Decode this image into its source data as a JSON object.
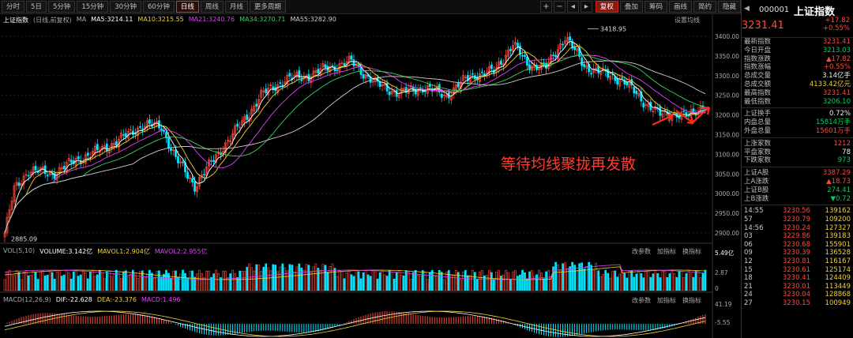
{
  "toolbar": {
    "periods": [
      "分时",
      "5日",
      "5分钟",
      "15分钟",
      "30分钟",
      "60分钟",
      "日线",
      "周线",
      "月线",
      "更多周期"
    ],
    "active_period": "日线",
    "right_buttons": [
      "复权",
      "叠加",
      "筹码",
      "画线",
      "简约",
      "隐藏"
    ],
    "plus": "+",
    "minus": "−",
    "left": "◂",
    "right": "▸"
  },
  "main_panel": {
    "title": "上证指数",
    "sub": "(日线,前复权)",
    "ma_label": "MA",
    "ma": [
      {
        "label": "MA5:3214.11",
        "color": "#ffffff"
      },
      {
        "label": "MA10:3215.55",
        "color": "#f2d230"
      },
      {
        "label": "MA21:3240.76",
        "color": "#e040fb"
      },
      {
        "label": "MA34:3270.71",
        "color": "#3cd25a"
      },
      {
        "label": "MA55:3282.90",
        "color": "#cccccc"
      }
    ],
    "settings": "设置均线",
    "high_label": "3418.95",
    "low_label": "2885.09",
    "y_ticks": [
      "3400.00",
      "3350.00",
      "3300.00",
      "3250.00",
      "3200.00",
      "3150.00",
      "3100.00",
      "3050.00",
      "3000.00",
      "2950.00",
      "2900.00"
    ]
  },
  "annotation": "等待均线聚拢再发散",
  "volume_panel": {
    "label": "VOL(5,10)",
    "items": [
      {
        "label": "VOLUME:3.142亿",
        "color": "#ffffff"
      },
      {
        "label": "MAVOL1:2.904亿",
        "color": "#f2d230"
      },
      {
        "label": "MAVOL2:2.955亿",
        "color": "#e040fb"
      }
    ],
    "tools": [
      "改参数",
      "加指标",
      "换指标"
    ],
    "y_ticks": [
      "5.49亿",
      "2.87",
      "0"
    ]
  },
  "macd_panel": {
    "label": "MACD(12,26,9)",
    "items": [
      {
        "label": "DIF:-22.628",
        "color": "#ffffff"
      },
      {
        "label": "DEA:-23.376",
        "color": "#f2d230"
      },
      {
        "label": "MACD:1.496",
        "color": "#e040fb"
      }
    ],
    "tools": [
      "改参数",
      "加指标",
      "换指标"
    ],
    "y_ticks": [
      "41.19",
      "-5.55"
    ]
  },
  "side": {
    "code": "000001",
    "name": "上证指数",
    "price": "3231.41",
    "change": "+17.82",
    "change_pct": "+0.55%",
    "stats": [
      {
        "k": "最新指数",
        "v": "3231.41",
        "c": "red"
      },
      {
        "k": "今日开盘",
        "v": "3213.03",
        "c": "green"
      },
      {
        "k": "指数涨跌",
        "v": "▲17.82",
        "c": "red"
      },
      {
        "k": "指数涨幅",
        "v": "+0.55%",
        "c": "red"
      },
      {
        "k": "总成交量",
        "v": "3.14亿手",
        "c": "white"
      },
      {
        "k": "总成交额",
        "v": "4133.42亿元",
        "c": "yellow"
      },
      {
        "k": "最高指数",
        "v": "3231.41",
        "c": "red"
      },
      {
        "k": "最低指数",
        "v": "3206.10",
        "c": "green"
      }
    ],
    "stats2": [
      {
        "k": "上证换手",
        "v": "0.72%",
        "c": "white"
      },
      {
        "k": "内盘总量",
        "v": "15814万手",
        "c": "green"
      },
      {
        "k": "外盘总量",
        "v": "15601万手",
        "c": "red"
      }
    ],
    "stats3": [
      {
        "k": "上涨家数",
        "v": "1212",
        "c": "red"
      },
      {
        "k": "平盘家数",
        "v": "78",
        "c": "white"
      },
      {
        "k": "下跌家数",
        "v": "973",
        "c": "green"
      }
    ],
    "stats4": [
      {
        "k": "上证A股",
        "v": "3387.29",
        "c": "red"
      },
      {
        "k": "上A涨跌",
        "v": "▲18.73",
        "c": "red"
      },
      {
        "k": "上证B股",
        "v": "274.41",
        "c": "green"
      },
      {
        "k": "上B涨跌",
        "v": "▼0.72",
        "c": "green"
      }
    ],
    "ticks": [
      {
        "t": "14:55",
        "p": "3230.56",
        "q": "139162"
      },
      {
        "t": "57",
        "p": "3230.79",
        "q": "109200"
      },
      {
        "t": "14:56",
        "p": "3230.24",
        "q": "127327"
      },
      {
        "t": "03",
        "p": "3229.86",
        "q": "139183"
      },
      {
        "t": "06",
        "p": "3230.68",
        "q": "155901"
      },
      {
        "t": "09",
        "p": "3230.39",
        "q": "136528"
      },
      {
        "t": "12",
        "p": "3230.81",
        "q": "116167"
      },
      {
        "t": "15",
        "p": "3230.61",
        "q": "125174"
      },
      {
        "t": "18",
        "p": "3230.41",
        "q": "124409"
      },
      {
        "t": "21",
        "p": "3230.01",
        "q": "113449"
      },
      {
        "t": "24",
        "p": "3230.04",
        "q": "128868"
      },
      {
        "t": "27",
        "p": "3230.15",
        "q": "100949"
      }
    ]
  },
  "colors": {
    "up": "#ff4a3a",
    "down": "#00e5ff",
    "bg": "#000000"
  }
}
